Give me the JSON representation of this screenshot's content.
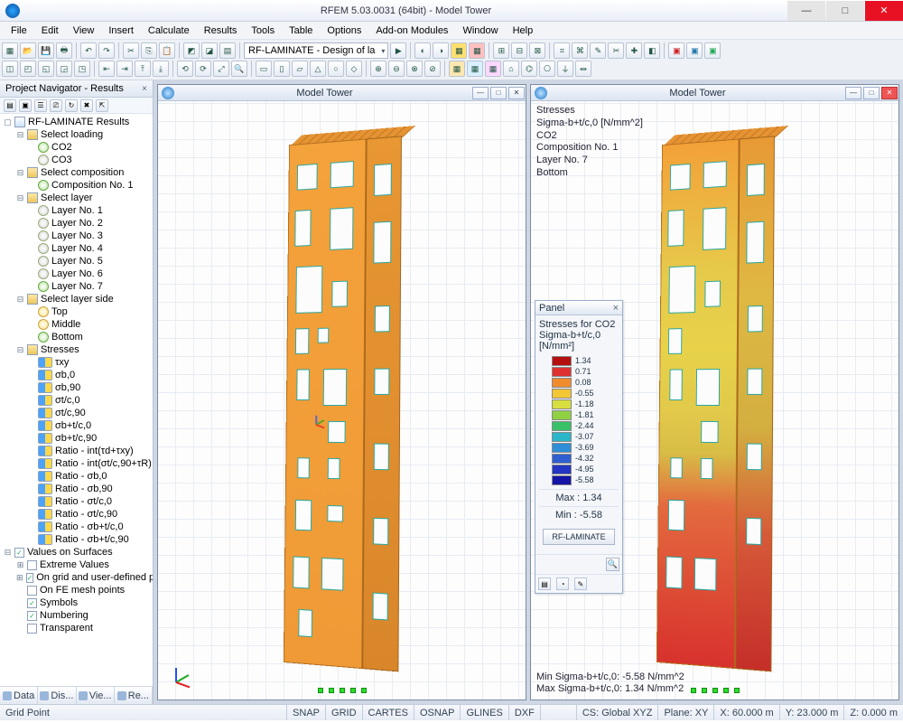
{
  "app": {
    "title": "RFEM 5.03.0031 (64bit) - Model Tower"
  },
  "menu": [
    "File",
    "Edit",
    "View",
    "Insert",
    "Calculate",
    "Results",
    "Tools",
    "Table",
    "Options",
    "Add-on Modules",
    "Window",
    "Help"
  ],
  "combo": {
    "label": "RF-LAMINATE - Design of la"
  },
  "navigator": {
    "title": "Project Navigator - Results",
    "root": "RF-LAMINATE Results",
    "sections": {
      "loading": {
        "label": "Select loading",
        "items": [
          "CO2",
          "CO3"
        ]
      },
      "composition": {
        "label": "Select composition",
        "items": [
          "Composition No. 1"
        ]
      },
      "layer": {
        "label": "Select layer",
        "items": [
          "Layer No. 1",
          "Layer No. 2",
          "Layer No. 3",
          "Layer No. 4",
          "Layer No. 5",
          "Layer No. 6",
          "Layer No. 7"
        ]
      },
      "layerside": {
        "label": "Select layer side",
        "items": [
          "Top",
          "Middle",
          "Bottom"
        ]
      },
      "stresses": {
        "label": "Stresses",
        "items": [
          "τxy",
          "σb,0",
          "σb,90",
          "σt/c,0",
          "σt/c,90",
          "σb+t/c,0",
          "σb+t/c,90",
          "Ratio - int(τd+τxy)",
          "Ratio - int(σt/c,90+τR)",
          "Ratio - σb,0",
          "Ratio - σb,90",
          "Ratio - σt/c,0",
          "Ratio - σt/c,90",
          "Ratio - σb+t/c,0",
          "Ratio - σb+t/c,90"
        ]
      },
      "values": {
        "label": "Values on Surfaces",
        "items": [
          "Extreme Values",
          "On grid and user-defined p",
          "On FE mesh points",
          "Symbols",
          "Numbering",
          "Transparent"
        ]
      }
    },
    "tabs": [
      "Data",
      "Dis...",
      "Vie...",
      "Re..."
    ]
  },
  "views": {
    "left": {
      "title": "Model Tower"
    },
    "right": {
      "title": "Model Tower",
      "overlay": [
        "Stresses",
        "Sigma-b+t/c,0 [N/mm^2]",
        "CO2",
        "Composition No. 1",
        "Layer No. 7",
        "Bottom"
      ],
      "footer_min": "Min Sigma-b+t/c,0: -5.58 N/mm^2",
      "footer_max": "Max Sigma-b+t/c,0: 1.34 N/mm^2"
    }
  },
  "panel": {
    "title": "Panel",
    "subtitle1": "Stresses for CO2",
    "subtitle2": "Sigma-b+t/c,0 [N/mm²]",
    "legend": [
      {
        "v": "1.34",
        "c": "#b50f0f"
      },
      {
        "v": "0.71",
        "c": "#e03131"
      },
      {
        "v": "0.08",
        "c": "#f08c2e"
      },
      {
        "v": "-0.55",
        "c": "#f3c634"
      },
      {
        "v": "-1.18",
        "c": "#d7de3e"
      },
      {
        "v": "-1.81",
        "c": "#8fd143"
      },
      {
        "v": "-2.44",
        "c": "#39c168"
      },
      {
        "v": "-3.07",
        "c": "#2bb5c9"
      },
      {
        "v": "-3.69",
        "c": "#2f8ed8"
      },
      {
        "v": "-4.32",
        "c": "#2f5fd0"
      },
      {
        "v": "-4.95",
        "c": "#2335c2"
      },
      {
        "v": "-5.58",
        "c": "#1414a6"
      }
    ],
    "max": "Max :   1.34",
    "min": "Min :  -5.58",
    "button": "RF-LAMINATE"
  },
  "status": {
    "left": "Grid Point",
    "toggles": [
      "SNAP",
      "GRID",
      "CARTES",
      "OSNAP",
      "GLINES",
      "DXF"
    ],
    "cs": "CS: Global XYZ",
    "plane": "Plane: XY",
    "x": "X: 60.000 m",
    "y": "Y: 23.000 m",
    "z": "Z: 0.000 m"
  }
}
